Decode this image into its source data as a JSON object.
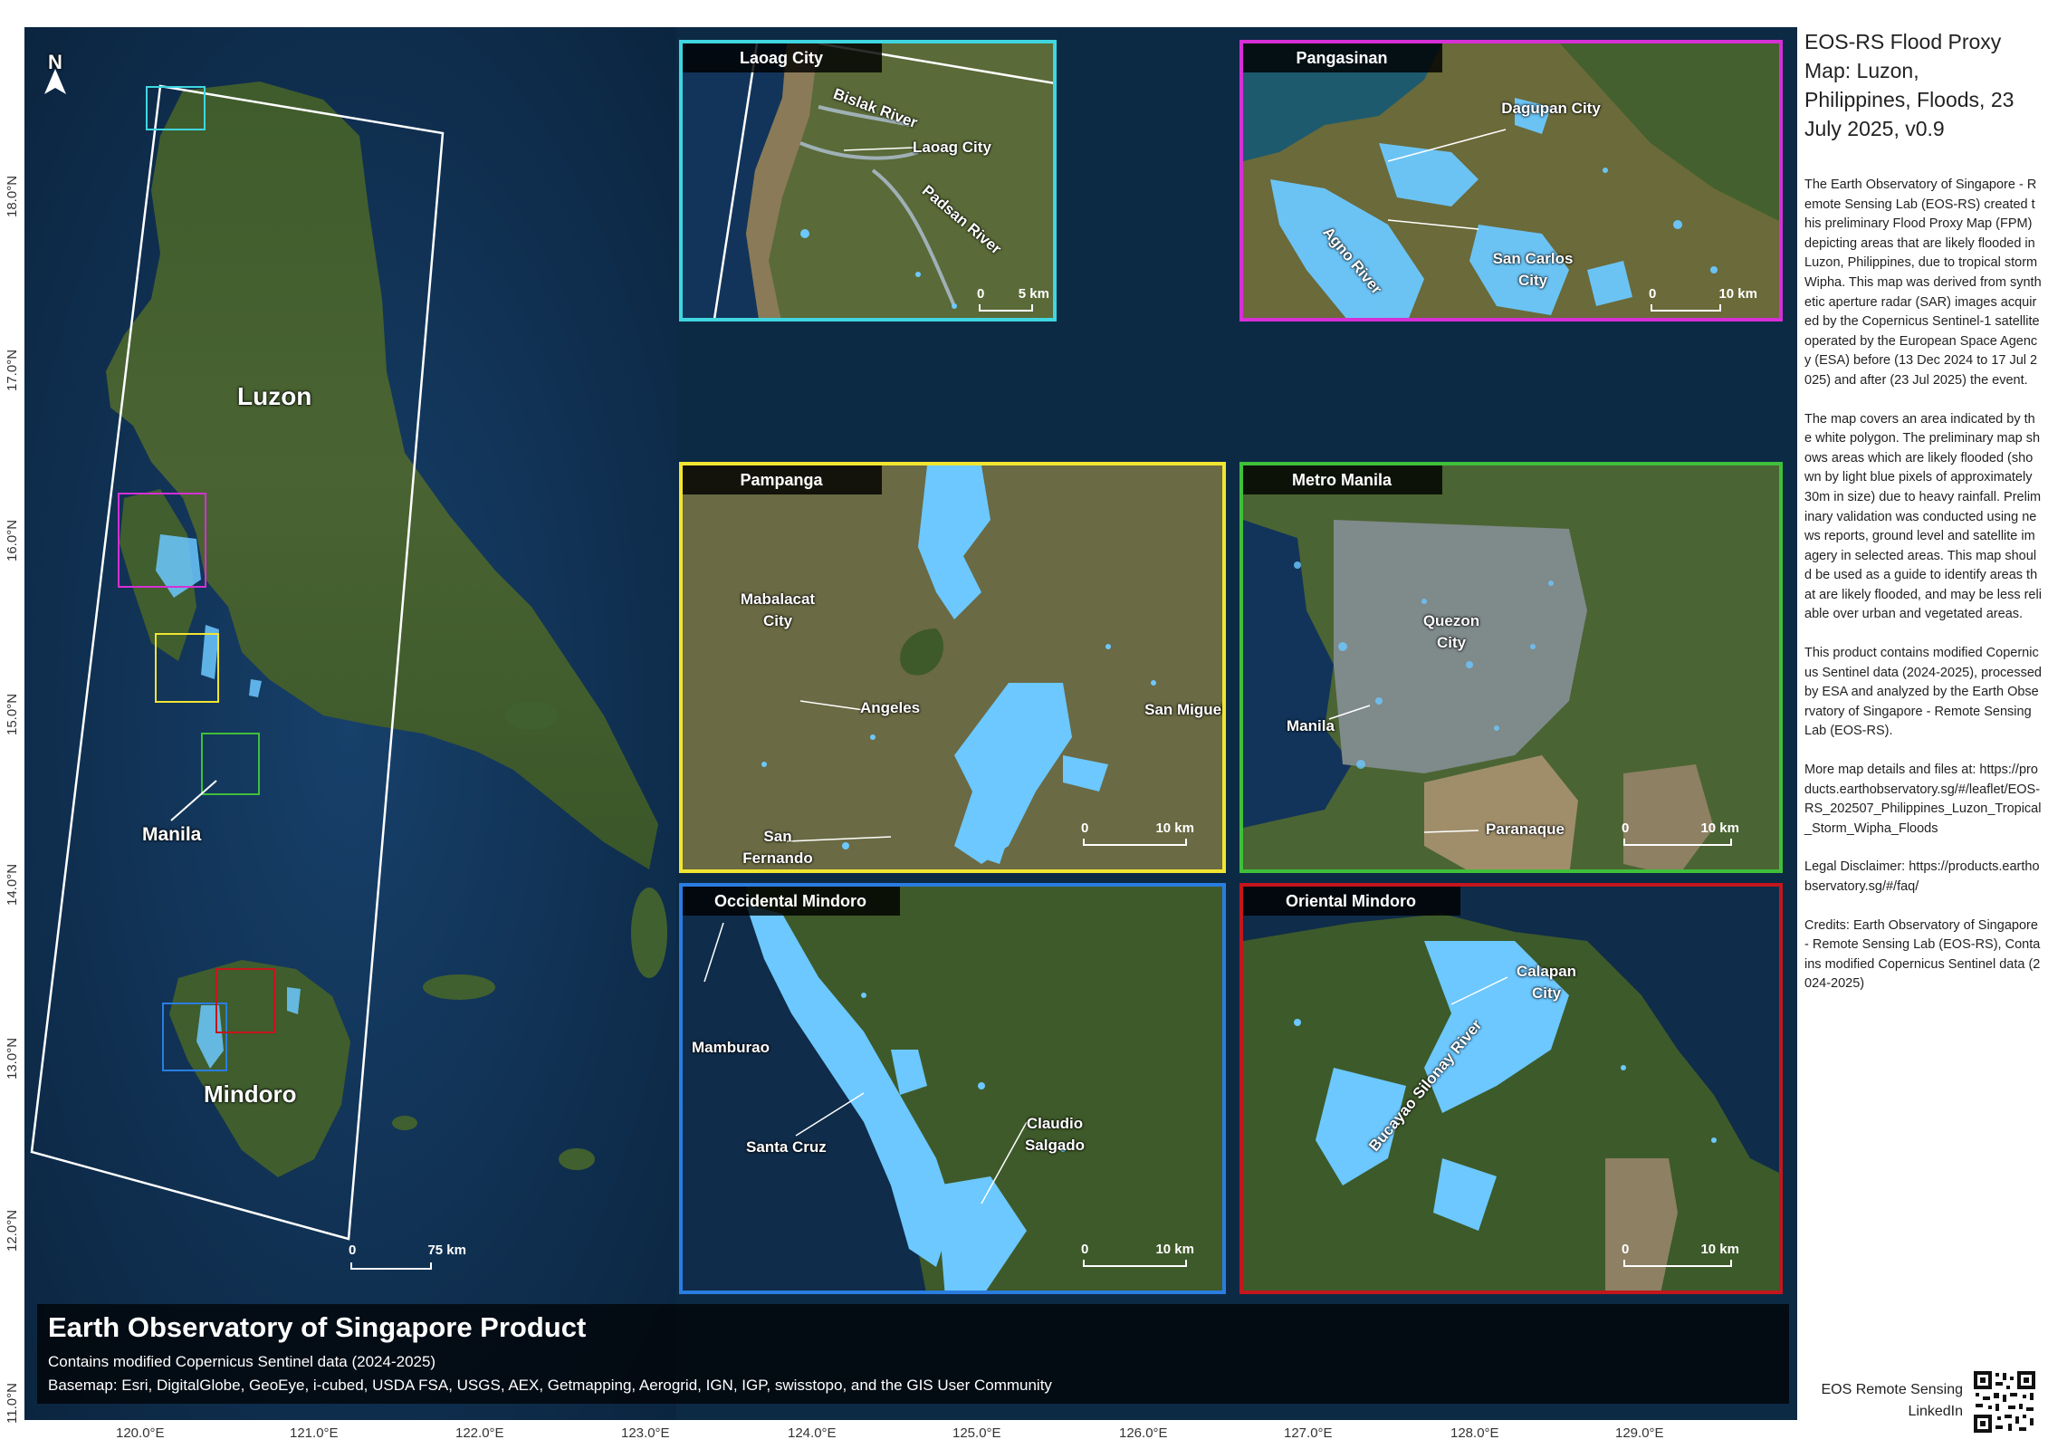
{
  "title": "EOS-RS Flood Proxy Map: Luzon, Philippines, Floods, 23 July 2025, v0.9",
  "description_paragraphs": [
    "The Earth Observatory of Singapore - Remote Sensing Lab (EOS-RS) created this preliminary Flood Proxy Map (FPM) depicting areas that are likely flooded in Luzon, Philippines, due to tropical storm Wipha. This map was derived from synthetic aperture radar (SAR) images acquired by the Copernicus Sentinel-1 satellite operated by the European Space Agency (ESA) before (13 Dec 2024 to 17 Jul 2025) and after (23 Jul 2025) the event.",
    "The map covers an area indicated by the white polygon. The preliminary map shows areas which are likely flooded (shown by light blue pixels of approximately 30m in size) due to heavy rainfall. Preliminary validation was conducted using news reports, ground level and satellite imagery in selected areas. This map should be used as a guide to identify areas that are likely flooded, and may be less reliable over urban and vegetated areas.",
    "This product contains modified Copernicus Sentinel data (2024-2025), processed by ESA and analyzed by the Earth Observatory of Singapore - Remote Sensing Lab (EOS-RS).",
    "More map details and files at: https://products.earthobservatory.sg/#/leaflet/EOS-RS_202507_Philippines_Luzon_Tropical_Storm_Wipha_Floods",
    "Legal Disclaimer: https://products.earthobservatory.sg/#/faq/",
    "Credits: Earth Observatory of Singapore - Remote Sensing Lab (EOS-RS), Contains modified Copernicus Sentinel data (2024-2025)"
  ],
  "qr_caption": "EOS Remote Sensing LinkedIn",
  "footer": {
    "title": "Earth Observatory of Singapore Product",
    "line1": "Contains modified Copernicus Sentinel data (2024-2025)",
    "line2": "Basemap: Esri, DigitalGlobe, GeoEye, i-cubed, USDA FSA, USGS, AEX, Getmapping, Aerogrid, IGN, IGP, swisstopo, and the GIS User Community"
  },
  "main_map": {
    "north_label": "N",
    "labels": {
      "luzon": "Luzon",
      "manila": "Manila",
      "mindoro": "Mindoro"
    },
    "scale": {
      "start": "0",
      "end": "75 km"
    }
  },
  "longitude_ticks": [
    "120.0°E",
    "121.0°E",
    "122.0°E",
    "123.0°E",
    "124.0°E",
    "125.0°E",
    "126.0°E",
    "127.0°E",
    "128.0°E",
    "129.0°E"
  ],
  "latitude_ticks": [
    "18.0°N",
    "17.0°N",
    "16.0°N",
    "15.0°N",
    "14.0°N",
    "13.0°N",
    "12.0°N",
    "11.0°N"
  ],
  "insets": [
    {
      "title": "Laoag City",
      "color": "#3fd6e0",
      "labels": [
        "Bislak River",
        "Laoag City",
        "Padsan River"
      ],
      "scale": {
        "start": "0",
        "end": "5 km"
      }
    },
    {
      "title": "Pangasinan",
      "color": "#d62fd6",
      "labels": [
        "Dagupan City",
        "San Carlos City",
        "Agno River"
      ],
      "scale": {
        "start": "0",
        "end": "10 km"
      }
    },
    {
      "title": "Pampanga",
      "color": "#f2e530",
      "labels": [
        "Mabalacat City",
        "Angeles",
        "San Miguel",
        "San Fernando"
      ],
      "scale": {
        "start": "0",
        "end": "10 km"
      }
    },
    {
      "title": "Metro Manila",
      "color": "#3fbf3a",
      "labels": [
        "Quezon City",
        "Manila",
        "Paranaque"
      ],
      "scale": {
        "start": "0",
        "end": "10 km"
      }
    },
    {
      "title": "Occidental Mindoro",
      "color": "#2a7de1",
      "labels": [
        "Mamburao",
        "Santa Cruz",
        "Claudio Salgado"
      ],
      "scale": {
        "start": "0",
        "end": "10 km"
      }
    },
    {
      "title": "Oriental Mindoro",
      "color": "#c4161c",
      "labels": [
        "Calapan City",
        "Bucayao Silonay River"
      ],
      "scale": {
        "start": "0",
        "end": "10 km"
      }
    }
  ],
  "colors": {
    "flood": "#6cc8ff",
    "land": "#3d5a2a",
    "water": "#0f2c4a",
    "polygon": "#ffffff"
  }
}
